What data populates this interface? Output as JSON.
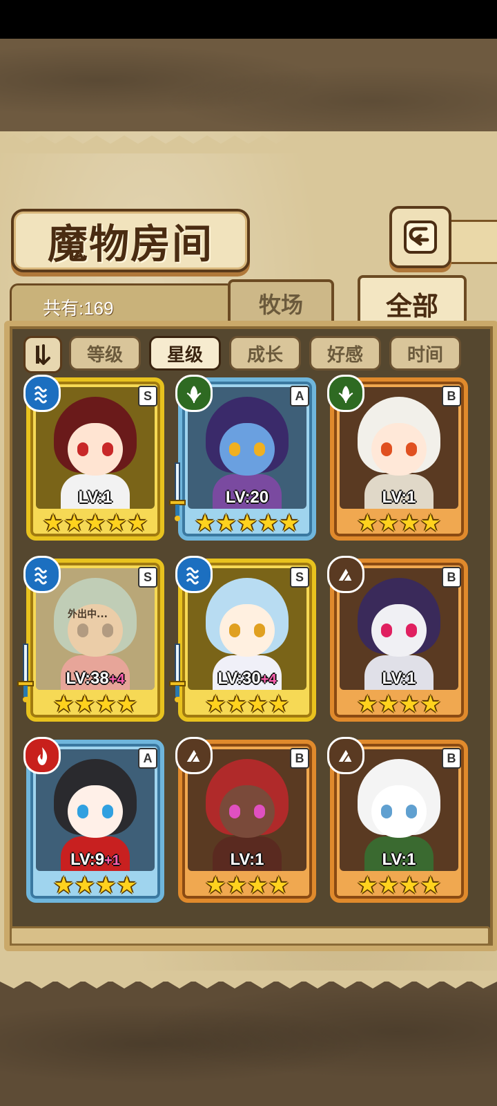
{
  "title": "魔物房间",
  "count_label": "共有:169",
  "tabs": [
    {
      "label": "牧场",
      "active": false
    },
    {
      "label": "全部",
      "active": true
    }
  ],
  "sort_buttons": [
    {
      "label": "等级",
      "active": false
    },
    {
      "label": "星级",
      "active": true
    },
    {
      "label": "成长",
      "active": false
    },
    {
      "label": "好感",
      "active": false
    },
    {
      "label": "时间",
      "active": false
    }
  ],
  "cards": [
    {
      "grade": "S",
      "element": "water",
      "lv": "LV:1",
      "plus": "",
      "stars": "★★★★★",
      "weapon": false,
      "away": "",
      "hair": "#6a1a1a",
      "face": "#ffe4d2",
      "eye": "#c82828",
      "body": "#f2f2f2"
    },
    {
      "grade": "A",
      "element": "leaf",
      "lv": "LV:20",
      "plus": "",
      "stars": "★★★★★",
      "weapon": true,
      "away": "",
      "hair": "#3a2a6a",
      "face": "#6aa0e0",
      "eye": "#f0b020",
      "body": "#7a4aa0"
    },
    {
      "grade": "B",
      "element": "leaf",
      "lv": "LV:1",
      "plus": "",
      "stars": "★★★★",
      "weapon": false,
      "away": "",
      "hair": "#f2f0ea",
      "face": "#ffe8d8",
      "eye": "#e05020",
      "body": "#e0d8c8"
    },
    {
      "grade": "S",
      "element": "water",
      "lv": "LV:38",
      "plus": "+4",
      "stars": "★★★★",
      "weapon": true,
      "away": "外出中...",
      "hair": "#8ab8a0",
      "face": "#e8b880",
      "eye": "#6a4a2a",
      "body": "#e06060"
    },
    {
      "grade": "S",
      "element": "water",
      "lv": "LV:30",
      "plus": "+4",
      "stars": "★★★★",
      "weapon": true,
      "away": "",
      "hair": "#b8dcf2",
      "face": "#fff0e0",
      "eye": "#e0a020",
      "body": "#f0f0f8"
    },
    {
      "grade": "B",
      "element": "earth",
      "lv": "LV:1",
      "plus": "",
      "stars": "★★★★",
      "weapon": false,
      "away": "",
      "hair": "#3a2a5a",
      "face": "#f0f0f4",
      "eye": "#e02060",
      "body": "#e0e0e8"
    },
    {
      "grade": "A",
      "element": "fire",
      "lv": "LV:9",
      "plus": "+1",
      "stars": "★★★★",
      "weapon": false,
      "away": "",
      "hair": "#2a2a2e",
      "face": "#fff0e8",
      "eye": "#30a0e0",
      "body": "#c82020"
    },
    {
      "grade": "B",
      "element": "earth",
      "lv": "LV:1",
      "plus": "",
      "stars": "★★★★",
      "weapon": false,
      "away": "",
      "hair": "#b02a2a",
      "face": "#7a4a3a",
      "eye": "#e050c0",
      "body": "#5a2a20"
    },
    {
      "grade": "B",
      "element": "earth",
      "lv": "LV:1",
      "plus": "",
      "stars": "★★★★",
      "weapon": false,
      "away": "",
      "hair": "#f4f4f4",
      "face": "#ffffff",
      "eye": "#60a0d0",
      "body": "#3a6a30"
    }
  ]
}
